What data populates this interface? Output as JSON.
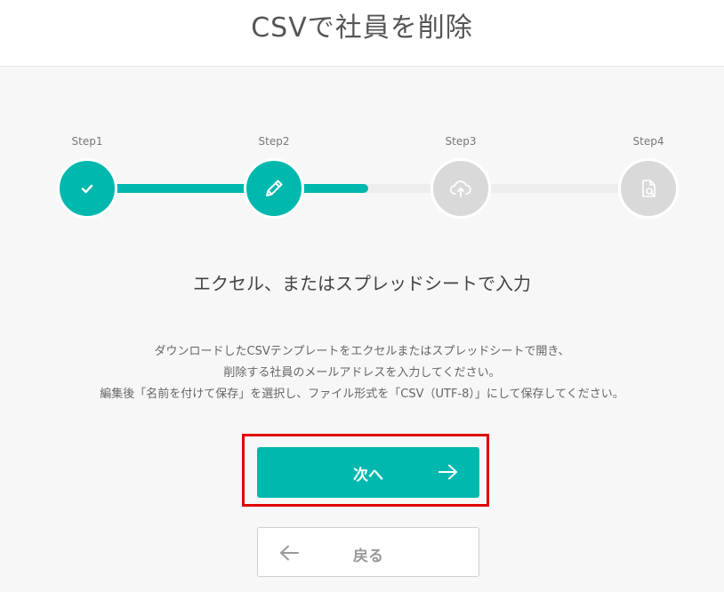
{
  "header": {
    "title": "CSVで社員を削除"
  },
  "stepper": {
    "steps": [
      {
        "label": "Step1",
        "icon": "check-icon",
        "state": "completed"
      },
      {
        "label": "Step2",
        "icon": "pencil-icon",
        "state": "current"
      },
      {
        "label": "Step3",
        "icon": "cloud-upload-icon",
        "state": "pending"
      },
      {
        "label": "Step4",
        "icon": "file-search-icon",
        "state": "pending"
      }
    ],
    "progress_fraction": 0.5,
    "colors": {
      "active": "#00b8ae",
      "inactive": "#d9d9d9",
      "track": "#eeeeee"
    }
  },
  "main": {
    "subtitle": "エクセル、またはスプレッドシートで入力",
    "description_lines": [
      "ダウンロードしたCSVテンプレートをエクセルまたはスプレッドシートで開き、",
      "削除する社員のメールアドレスを入力してください。",
      "編集後「名前を付けて保存」を選択し、ファイル形式を「CSV（UTF-8）」にして保存してください。"
    ]
  },
  "actions": {
    "next_label": "次へ",
    "back_label": "戻る",
    "accent_color": "#00b8ae",
    "highlight_color": "#e00000"
  }
}
